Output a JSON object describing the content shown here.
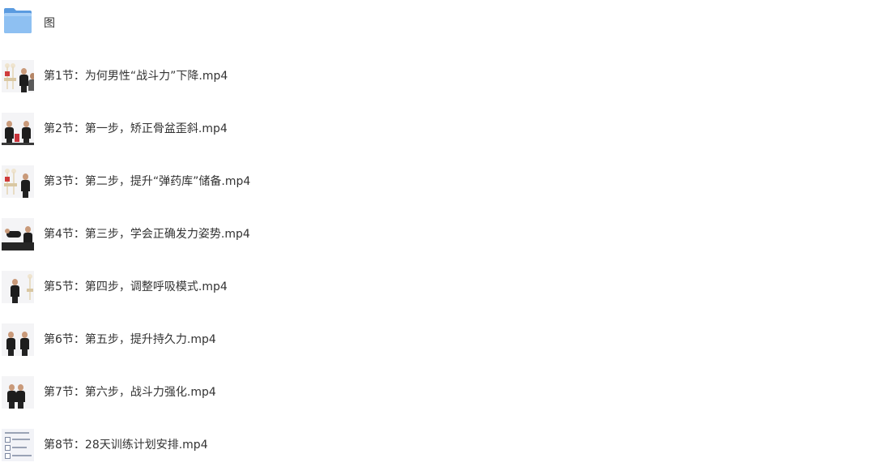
{
  "items": [
    {
      "kind": "folder",
      "name": "图",
      "icon": "folder-icon",
      "color": "#7fb5ec"
    },
    {
      "kind": "video",
      "name": "第1节：为何男性“战斗力”下降.mp4",
      "thumb": "skeleton-person"
    },
    {
      "kind": "video",
      "name": "第2节：第一步，矫正骨盆歪斜.mp4",
      "thumb": "two-persons-red"
    },
    {
      "kind": "video",
      "name": "第3节：第二步，提升“弹药库”储备.mp4",
      "thumb": "skeleton-person"
    },
    {
      "kind": "video",
      "name": "第4节：第三步，学会正确发力姿势.mp4",
      "thumb": "floor-exercise"
    },
    {
      "kind": "video",
      "name": "第5节：第四步，调整呼吸模式.mp4",
      "thumb": "person-skeleton"
    },
    {
      "kind": "video",
      "name": "第6节：第五步，提升持久力.mp4",
      "thumb": "two-persons"
    },
    {
      "kind": "video",
      "name": "第7节：第六步，战斗力强化.mp4",
      "thumb": "two-persons-close"
    },
    {
      "kind": "video",
      "name": "第8节：28天训练计划安排.mp4",
      "thumb": "document"
    }
  ]
}
